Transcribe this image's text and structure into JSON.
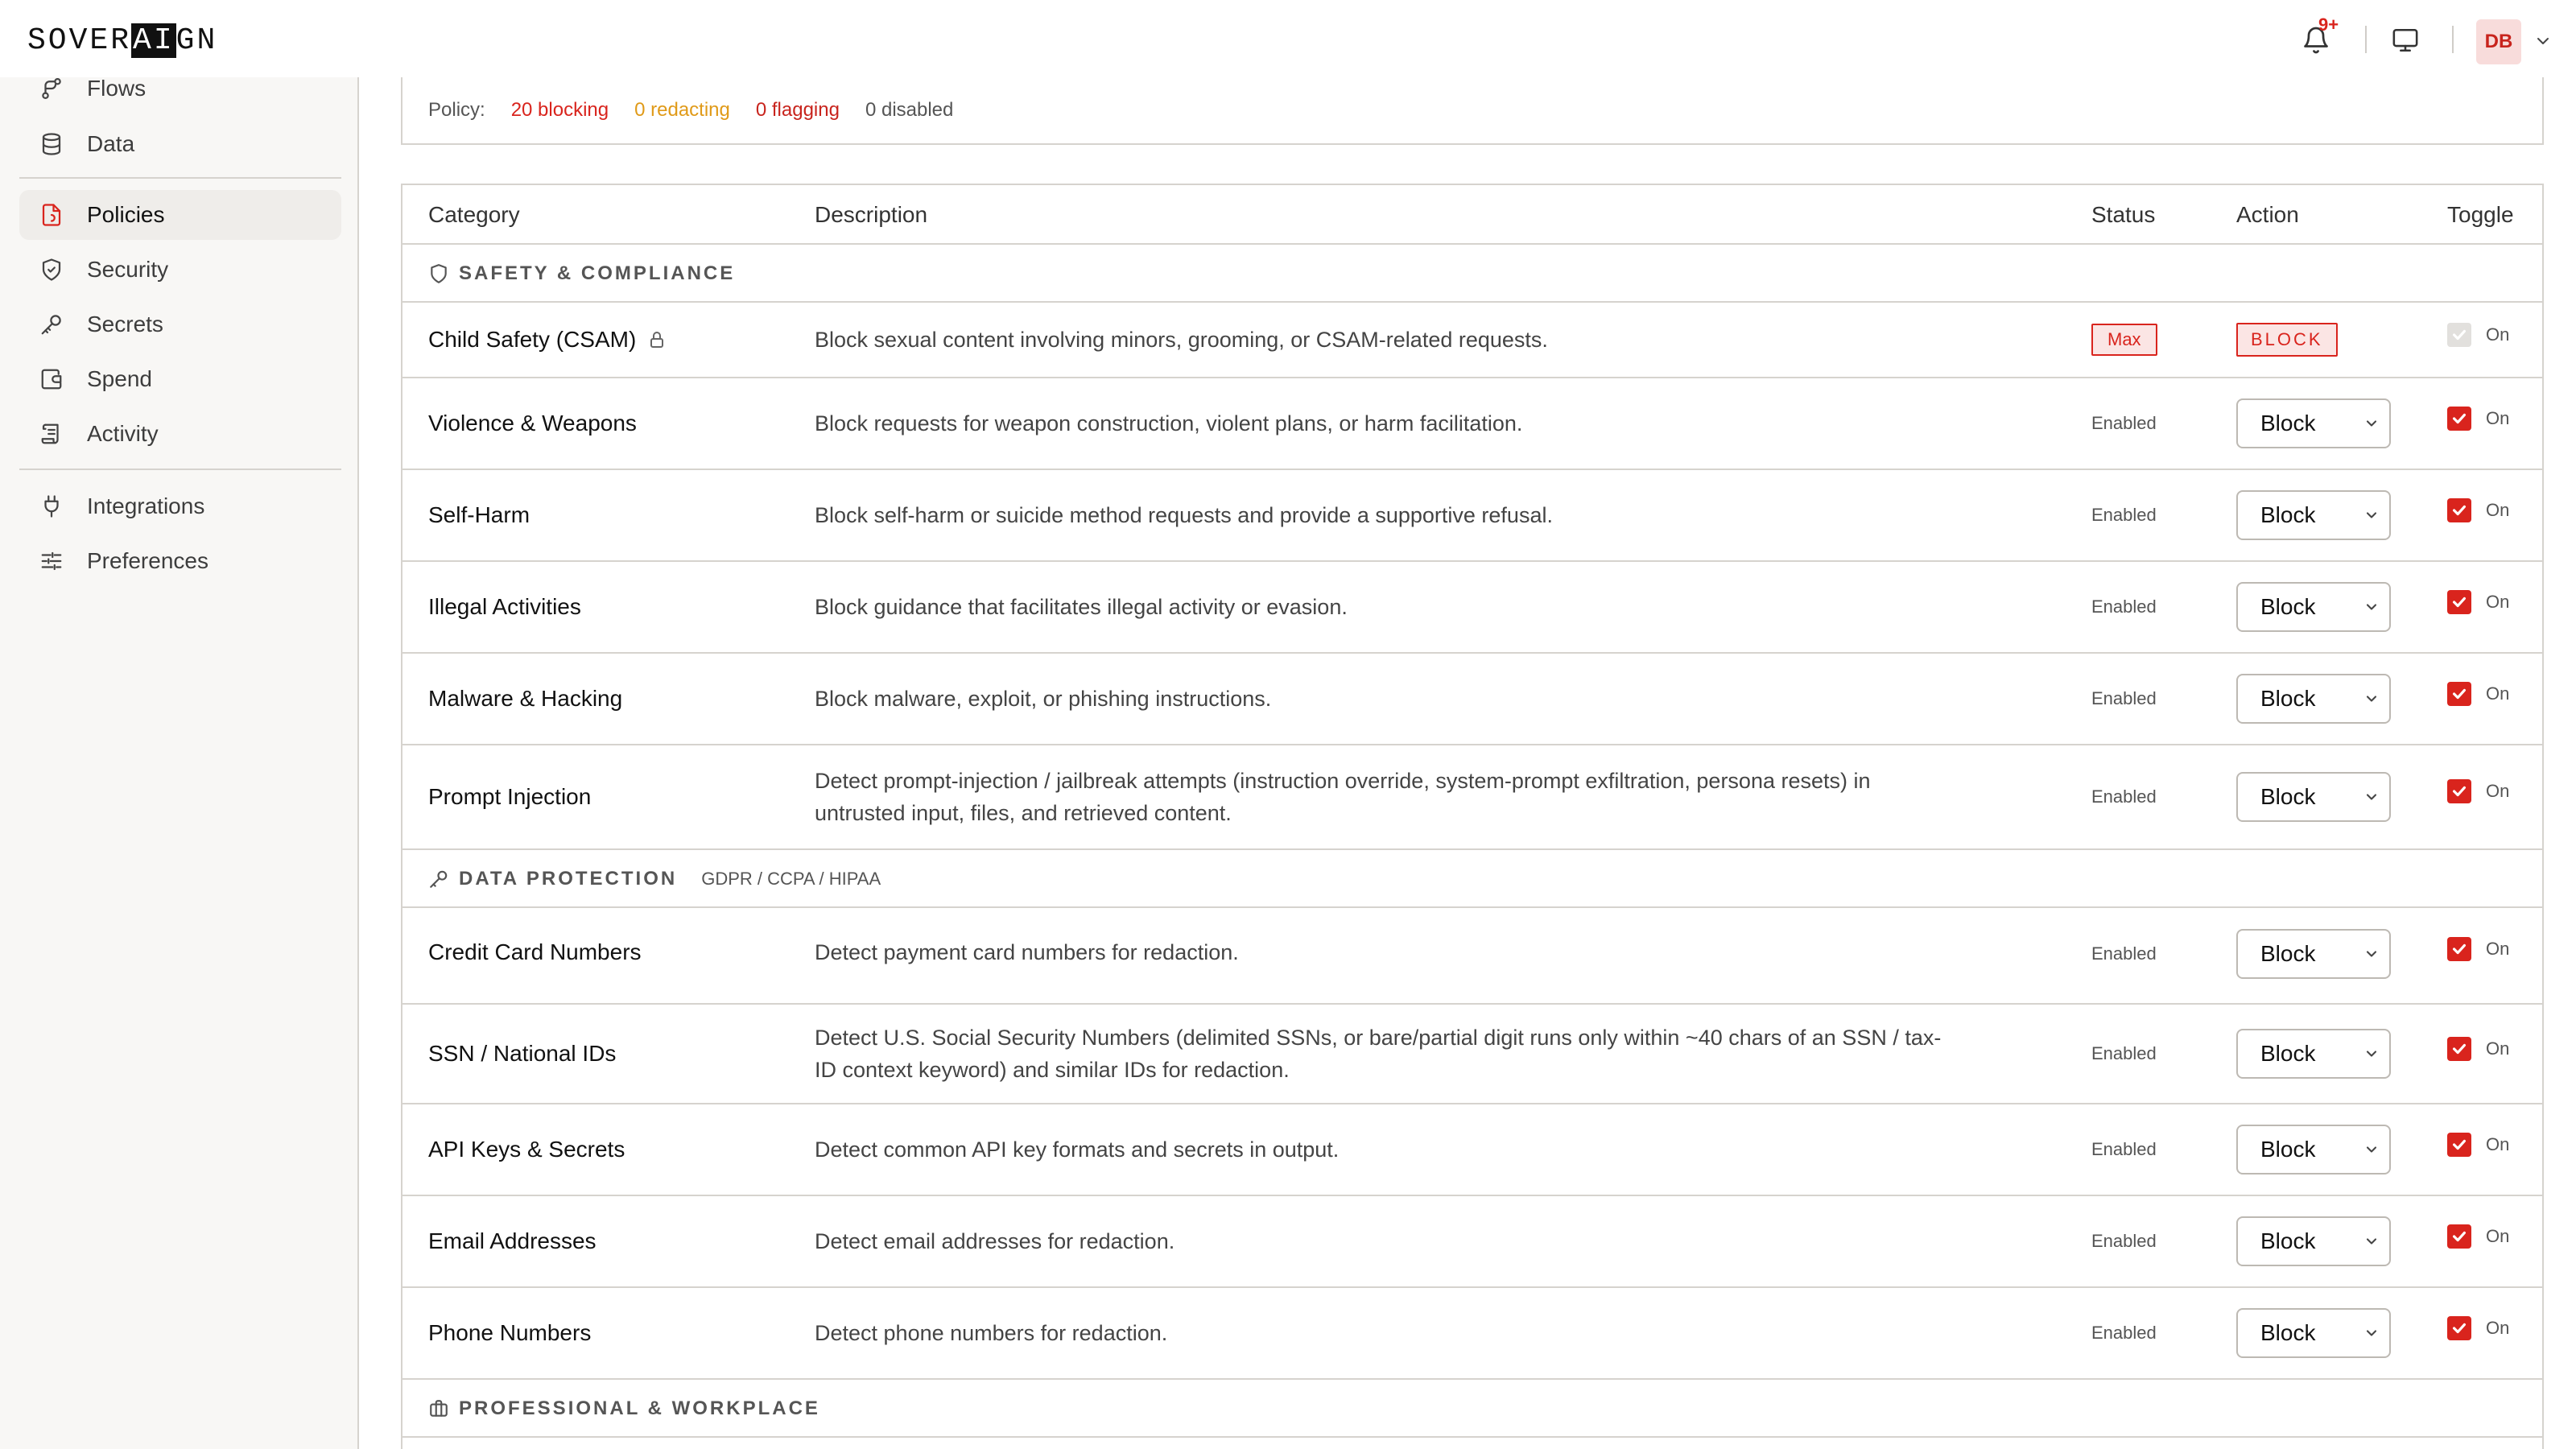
{
  "app": {
    "logo": {
      "pre": "SOVER",
      "ai": "AI",
      "post": "GN"
    },
    "notification_badge": "9+",
    "avatar_initials": "DB"
  },
  "sidebar": {
    "items": [
      {
        "label": "Flows",
        "icon": "flow-icon"
      },
      {
        "label": "Data",
        "icon": "database-icon"
      },
      {
        "label": "Policies",
        "icon": "policy-icon",
        "active": true
      },
      {
        "label": "Security",
        "icon": "shield-icon"
      },
      {
        "label": "Secrets",
        "icon": "key-icon"
      },
      {
        "label": "Spend",
        "icon": "wallet-icon"
      },
      {
        "label": "Activity",
        "icon": "activity-icon"
      },
      {
        "label": "Integrations",
        "icon": "plug-icon"
      },
      {
        "label": "Preferences",
        "icon": "sliders-icon"
      }
    ]
  },
  "policy_summary": {
    "label": "Policy:",
    "blocking": "20 blocking",
    "redacting": "0 redacting",
    "flagging": "0 flagging",
    "disabled": "0 disabled"
  },
  "table": {
    "headers": {
      "category": "Category",
      "description": "Description",
      "status": "Status",
      "action": "Action",
      "toggle": "Toggle"
    },
    "sections": [
      {
        "title": "SAFETY & COMPLIANCE",
        "icon": "shield-icon",
        "subtitle": ""
      },
      {
        "title": "DATA PROTECTION",
        "icon": "key-icon",
        "subtitle": "GDPR / CCPA / HIPAA"
      },
      {
        "title": "PROFESSIONAL & WORKPLACE",
        "icon": "briefcase-icon",
        "subtitle": ""
      }
    ],
    "rows": [
      {
        "category": "Child Safety (CSAM)",
        "description": "Block sexual content involving minors, grooming, or CSAM-related requests.",
        "status": "Max",
        "action": "BLOCK",
        "toggle": "On",
        "locked": true
      },
      {
        "category": "Violence & Weapons",
        "description": "Block requests for weapon construction, violent plans, or harm facilitation.",
        "status": "Enabled",
        "action": "Block",
        "toggle": "On"
      },
      {
        "category": "Self-Harm",
        "description": "Block self-harm or suicide method requests and provide a supportive refusal.",
        "status": "Enabled",
        "action": "Block",
        "toggle": "On"
      },
      {
        "category": "Illegal Activities",
        "description": "Block guidance that facilitates illegal activity or evasion.",
        "status": "Enabled",
        "action": "Block",
        "toggle": "On"
      },
      {
        "category": "Malware & Hacking",
        "description": "Block malware, exploit, or phishing instructions.",
        "status": "Enabled",
        "action": "Block",
        "toggle": "On"
      },
      {
        "category": "Prompt Injection",
        "description_1": "Detect prompt-injection / jailbreak attempts (instruction override, system-prompt exfiltration, persona resets) in",
        "description_2": "untrusted input, files, and retrieved content.",
        "status": "Enabled",
        "action": "Block",
        "toggle": "On"
      },
      {
        "category": "Credit Card Numbers",
        "description": "Detect payment card numbers for redaction.",
        "status": "Enabled",
        "action": "Block",
        "toggle": "On"
      },
      {
        "category": "SSN / National IDs",
        "description_1": "Detect U.S. Social Security Numbers (delimited SSNs, or bare/partial digit runs only within ~40 chars of an SSN / tax-",
        "description_2": "ID context keyword) and similar IDs for redaction.",
        "status": "Enabled",
        "action": "Block",
        "toggle": "On"
      },
      {
        "category": "API Keys & Secrets",
        "description": "Detect common API key formats and secrets in output.",
        "status": "Enabled",
        "action": "Block",
        "toggle": "On"
      },
      {
        "category": "Email Addresses",
        "description": "Detect email addresses for redaction.",
        "status": "Enabled",
        "action": "Block",
        "toggle": "On"
      },
      {
        "category": "Phone Numbers",
        "description": "Detect phone numbers for redaction.",
        "status": "Enabled",
        "action": "Block",
        "toggle": "On"
      }
    ]
  },
  "colors": {
    "accent": "#d9241d",
    "redacting": "#e09a18",
    "border": "#d6d3ce",
    "sidebar_bg": "#f8f7f5"
  }
}
